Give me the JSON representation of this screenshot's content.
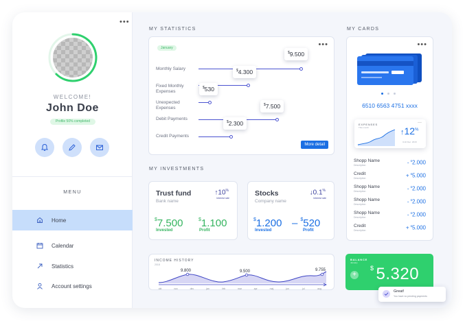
{
  "user": {
    "welcome": "WELCOME!",
    "name": "John Doe",
    "profile_status": "Profile 50% completed",
    "profile_progress": 0.5
  },
  "actions": [
    {
      "icon": "bell-icon"
    },
    {
      "icon": "pencil-icon"
    },
    {
      "icon": "mail-icon"
    }
  ],
  "menu": {
    "title": "MENU",
    "items": [
      {
        "label": "Home",
        "icon": "home-icon",
        "active": true
      },
      {
        "label": "Calendar",
        "icon": "calendar-icon",
        "active": false
      },
      {
        "label": "Statistics",
        "icon": "arrow-up-right-icon",
        "active": false
      },
      {
        "label": "Account settings",
        "icon": "user-icon",
        "active": false
      }
    ]
  },
  "statistics": {
    "title": "MY STATISTICS",
    "period": "January",
    "button": "More detail",
    "rows": [
      {
        "label": "Monthly Salary",
        "value": "9.500"
      },
      {
        "label": "Fixed Monthly Expenses",
        "value": "4.300"
      },
      {
        "label": "Unexpected Expenses",
        "value": "530"
      },
      {
        "label": "Debit Payments",
        "value": "7.500"
      },
      {
        "label": "Credit Payments",
        "value": "2.300"
      }
    ]
  },
  "investments": {
    "title": "MY INVESTMENTS",
    "cards": [
      {
        "name": "Trust fund",
        "sub": "Bank name",
        "rate": "10",
        "rate_label": "Interest rate",
        "invested": "7.500",
        "profit": "1.100",
        "invested_label": "Invested",
        "profit_label": "Profit"
      },
      {
        "name": "Stocks",
        "sub": "Company name",
        "rate": "0.1",
        "rate_label": "Interest rate",
        "invested": "1.200",
        "profit": "520",
        "invested_label": "Invested",
        "profit_label": "Profit"
      }
    ]
  },
  "income_history": {
    "title": "INCOME HISTORY",
    "year": "2018",
    "labels": [
      "9.800",
      "9.500",
      "9.755"
    ],
    "months": [
      "okt",
      "nov",
      "dec",
      "jan",
      "feb",
      "mar",
      "apr",
      "maj",
      "jun",
      "jul",
      "aug"
    ]
  },
  "cards": {
    "title": "MY CARDS",
    "number": "6510 6563 4751 xxxx",
    "expenses": {
      "title": "EXPENSES",
      "sub": "This month",
      "value": "12",
      "caption": "Until Dec. 2018"
    },
    "transactions": [
      {
        "name": "Shopp Name",
        "desc": "Description",
        "amount": "- 2.000"
      },
      {
        "name": "Credit",
        "desc": "Description",
        "amount": "+ 5.000"
      },
      {
        "name": "Shopp Name",
        "desc": "Description",
        "amount": "- 2.000"
      },
      {
        "name": "Shopp Name",
        "desc": "Description",
        "amount": "- 2.000"
      },
      {
        "name": "Shopp Name",
        "desc": "Description",
        "amount": "- 2.000"
      },
      {
        "name": "Credit",
        "desc": "Description",
        "amount": "+ 5.000"
      }
    ]
  },
  "balance": {
    "title": "BALANCE",
    "sub": "January",
    "value": "5.320"
  },
  "toast": {
    "title": "Great!",
    "message": "You have no pending payments"
  },
  "colors": {
    "accent": "#1b6fe3",
    "green": "#2fd06e",
    "navy_line": "#4a52d0"
  }
}
